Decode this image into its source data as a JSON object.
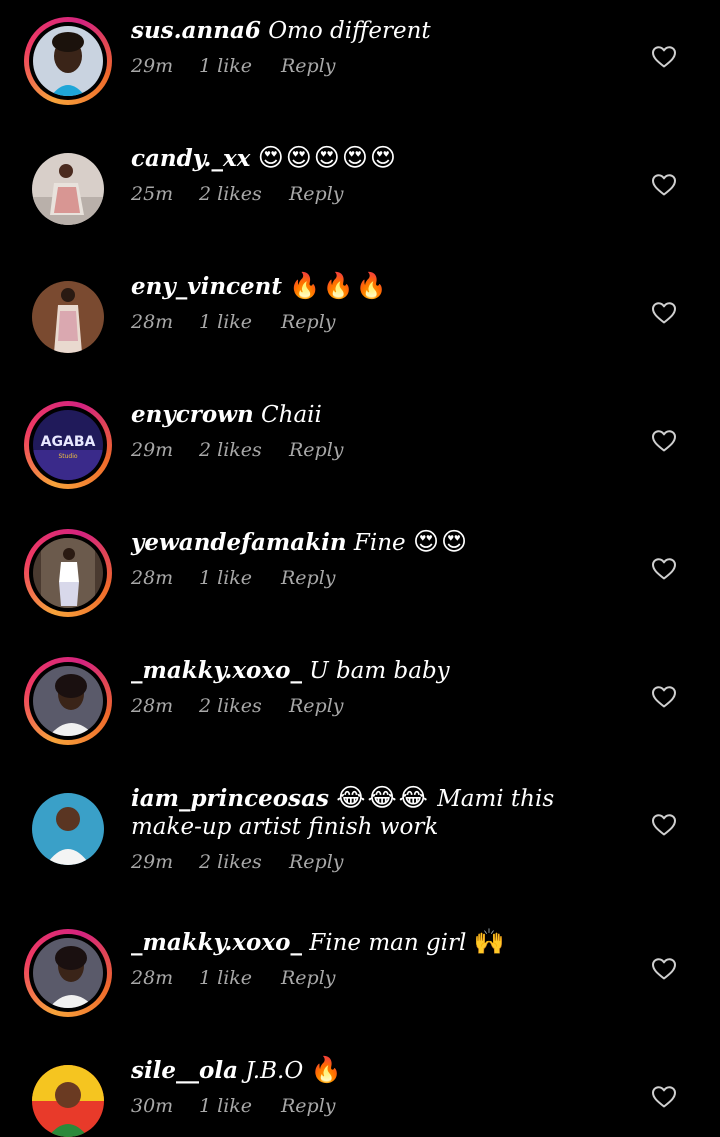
{
  "comments": [
    {
      "username": "sus.anna6",
      "text": "Omo different",
      "emoji": "",
      "time": "29m",
      "likes": "1 like",
      "reply": "Reply",
      "ring": true,
      "avatar": "woman-portrait"
    },
    {
      "username": "candy._xx",
      "text": "",
      "emoji": "😍😍😍😍😍",
      "time": "25m",
      "likes": "2 likes",
      "reply": "Reply",
      "ring": false,
      "avatar": "woman-sitting"
    },
    {
      "username": "eny_vincent",
      "text": "",
      "emoji": "🔥🔥🔥",
      "time": "28m",
      "likes": "1 like",
      "reply": "Reply",
      "ring": false,
      "avatar": "woman-standing"
    },
    {
      "username": "enycrown",
      "text": "Chaii",
      "emoji": "",
      "time": "29m",
      "likes": "2 likes",
      "reply": "Reply",
      "ring": true,
      "avatar": "agaba-poster"
    },
    {
      "username": "yewandefamakin",
      "text": "Fine",
      "emoji": "😍😍",
      "time": "28m",
      "likes": "1 like",
      "reply": "Reply",
      "ring": true,
      "avatar": "woman-pose"
    },
    {
      "username": "_makky.xoxo_",
      "text": "U bam baby",
      "emoji": "",
      "time": "28m",
      "likes": "2 likes",
      "reply": "Reply",
      "ring": true,
      "avatar": "woman-selfie"
    },
    {
      "username": "iam_princeosas",
      "text": "Mami this make-up artist finish work",
      "emoji": "😂😂😂",
      "emoji_first": true,
      "time": "29m",
      "likes": "2 likes",
      "reply": "Reply",
      "ring": false,
      "avatar": "man-smiling"
    },
    {
      "username": "_makky.xoxo_",
      "text": "Fine man girl",
      "emoji": "🙌",
      "time": "28m",
      "likes": "1 like",
      "reply": "Reply",
      "ring": true,
      "avatar": "woman-selfie"
    },
    {
      "username": "sile__ola",
      "text": "J.B.O",
      "emoji": "🔥",
      "time": "30m",
      "likes": "1 like",
      "reply": "Reply",
      "ring": false,
      "avatar": "woman-colorful"
    }
  ],
  "icons": {
    "like": "heart-outline-icon"
  },
  "colors": {
    "background": "#000000",
    "text": "#ffffff",
    "meta": "#a8a8a8",
    "ring_start": "#f7a33b",
    "ring_end": "#d3237f"
  }
}
